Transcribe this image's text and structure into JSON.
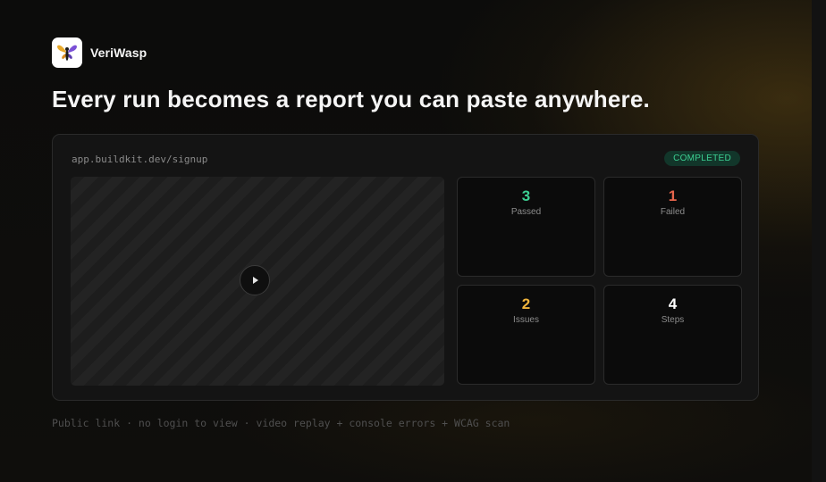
{
  "brand": {
    "name": "VeriWasp",
    "logo_icon": "wasp-logo-icon"
  },
  "headline": "Every run becomes a report you can paste anywhere.",
  "report": {
    "url": "app.buildkit.dev/signup",
    "status": "COMPLETED",
    "status_color": "#3ccf92",
    "video": {
      "play_icon": "play-icon"
    },
    "stats": [
      {
        "value": "3",
        "label": "Passed",
        "color": "#3ccf92"
      },
      {
        "value": "1",
        "label": "Failed",
        "color": "#e5654c"
      },
      {
        "value": "2",
        "label": "Issues",
        "color": "#f0b43c"
      },
      {
        "value": "4",
        "label": "Steps",
        "color": "#ffffff"
      }
    ]
  },
  "footer": "Public link · no login to view · video replay + console errors + WCAG scan",
  "colors": {
    "background": "#0d0d0c",
    "card": "#141414",
    "accent_glow": "#785816"
  }
}
